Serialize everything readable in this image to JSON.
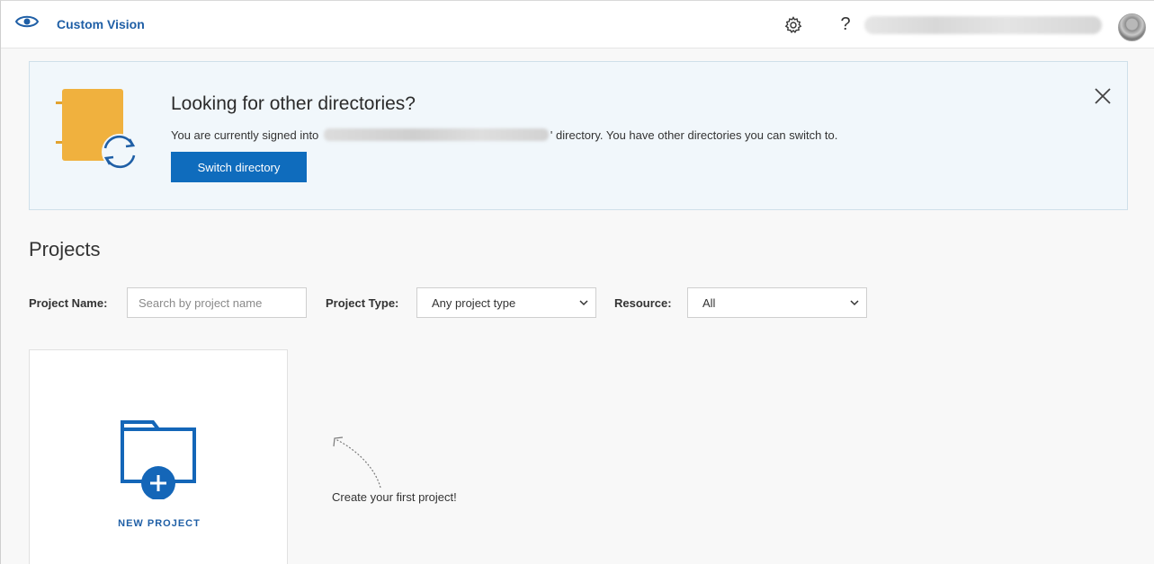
{
  "header": {
    "app_name": "Custom Vision",
    "help_glyph": "?",
    "icons": [
      "eye-icon",
      "gear-icon",
      "help-icon",
      "avatar"
    ]
  },
  "banner": {
    "title": "Looking for other directories?",
    "text_prefix": "You are currently signed into",
    "text_suffix": "' directory. You have other directories you can switch to.",
    "switch_label": "Switch directory",
    "close_icon": "close-icon",
    "illustration": "directory-switch-icon"
  },
  "projects": {
    "title": "Projects",
    "name_label": "Project Name:",
    "search_placeholder": "Search by project name",
    "type_label": "Project Type:",
    "type_value": "Any project type",
    "resource_label": "Resource:",
    "resource_value": "All",
    "new_project_label": "NEW PROJECT",
    "hint_text": "Create your first project!"
  },
  "colors": {
    "accent": "#0f6cbd",
    "link": "#1f5fa6",
    "banner_bg": "#f1f7fb",
    "illustration_yellow": "#f0b13e"
  }
}
